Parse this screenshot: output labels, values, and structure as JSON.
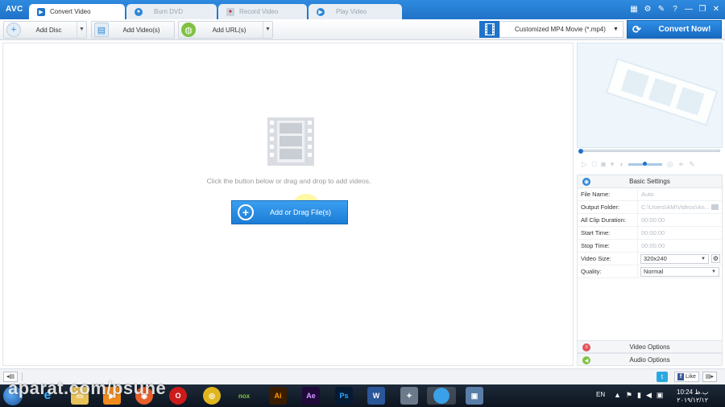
{
  "app": {
    "logo": "AVC"
  },
  "tabs": [
    {
      "label": "Convert Video",
      "active": true,
      "icon": "convert-video-icon"
    },
    {
      "label": "Burn DVD",
      "active": false,
      "icon": "disc-icon"
    },
    {
      "label": "Record Video",
      "active": false,
      "icon": "record-icon"
    },
    {
      "label": "Play Video",
      "active": false,
      "icon": "play-icon"
    }
  ],
  "toolbar": {
    "add_disc": "Add Disc",
    "add_videos": "Add Video(s)",
    "add_urls": "Add URL(s)",
    "format": "Customized MP4 Movie (*.mp4)",
    "convert_now": "Convert Now!"
  },
  "main": {
    "hint": "Click the button below or drag and drop to add videos.",
    "add_drag": "Add or Drag File(s)"
  },
  "settings": {
    "header": "Basic Settings",
    "rows": [
      {
        "label": "File Name:",
        "value": "Auto"
      },
      {
        "label": "Output Folder:",
        "value": "C:\\Users\\AM\\Videos\\An..."
      },
      {
        "label": "All Clip Duration:",
        "value": "00:00:00"
      },
      {
        "label": "Start Time:",
        "value": "00:00:00"
      },
      {
        "label": "Stop Time:",
        "value": "00:00:00"
      },
      {
        "label": "Video Size:",
        "value": "320x240"
      },
      {
        "label": "Quality:",
        "value": "Normal"
      }
    ]
  },
  "options": {
    "video": "Video Options",
    "audio": "Audio Options"
  },
  "statusbar": {
    "like": "Like"
  },
  "taskbar": {
    "lang": "EN",
    "time": "10:24 ب.ظ",
    "date": "۲۰۱۹/۱۲/۱۲"
  },
  "watermark": "aparat.com/psune",
  "colors": {
    "accent": "#1f73c8",
    "convert_btn": "#1769c0",
    "add_drag_btn": "#2a8de6"
  }
}
